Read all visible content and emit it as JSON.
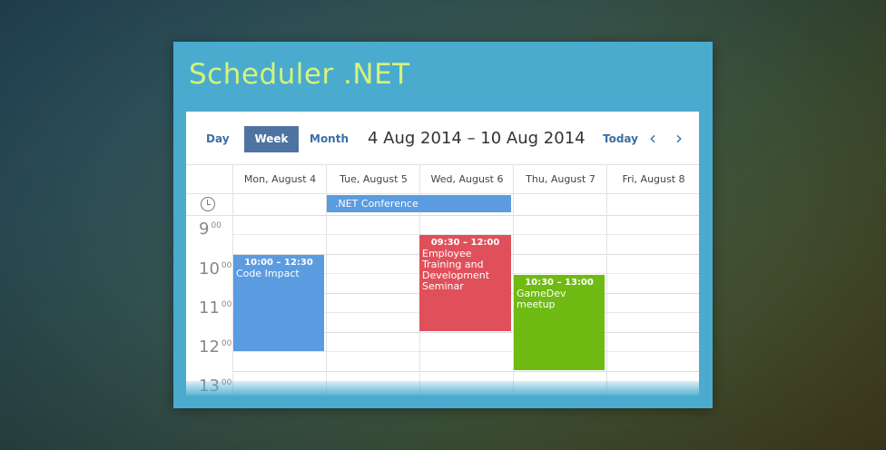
{
  "app": {
    "title": "Scheduler .NET"
  },
  "toolbar": {
    "day_label": "Day",
    "week_label": "Week",
    "month_label": "Month",
    "date_range": "4 Aug 2014 – 10 Aug 2014",
    "today_label": "Today",
    "prev_glyph": "‹",
    "next_glyph": "›",
    "active_view": "Week"
  },
  "columns": [
    "Mon, August 4",
    "Tue, August 5",
    "Wed, August 6",
    "Thu, August 7",
    "Fri, August 8"
  ],
  "hours": [
    {
      "hour": "9",
      "min": "00"
    },
    {
      "hour": "10",
      "min": "00"
    },
    {
      "hour": "11",
      "min": "00"
    },
    {
      "hour": "12",
      "min": "00"
    },
    {
      "hour": "13",
      "min": "00"
    }
  ],
  "allday_events": [
    {
      "title": ".NET Conference",
      "days": "Tue, August 5 – Wed, August 6"
    }
  ],
  "events": [
    {
      "time": "10:00 – 12:30",
      "title": "Code Impact",
      "day": "Mon, August 4",
      "color": "#5b9be0"
    },
    {
      "time": "09:30 – 12:00",
      "title": "Employee Training and Development Seminar",
      "day": "Wed, August 6",
      "color": "#e0505a"
    },
    {
      "time": "10:30 – 13:00",
      "title": "GameDev meetup",
      "day": "Thu, August 7",
      "color": "#6fba13"
    }
  ],
  "colors": {
    "panel": "#4aabcf",
    "title": "#d6f37a",
    "active_tab": "#4f73a0",
    "link": "#3c6fa5"
  },
  "icons": {
    "allday": "clock-icon",
    "prev": "chevron-left-icon",
    "next": "chevron-right-icon"
  }
}
